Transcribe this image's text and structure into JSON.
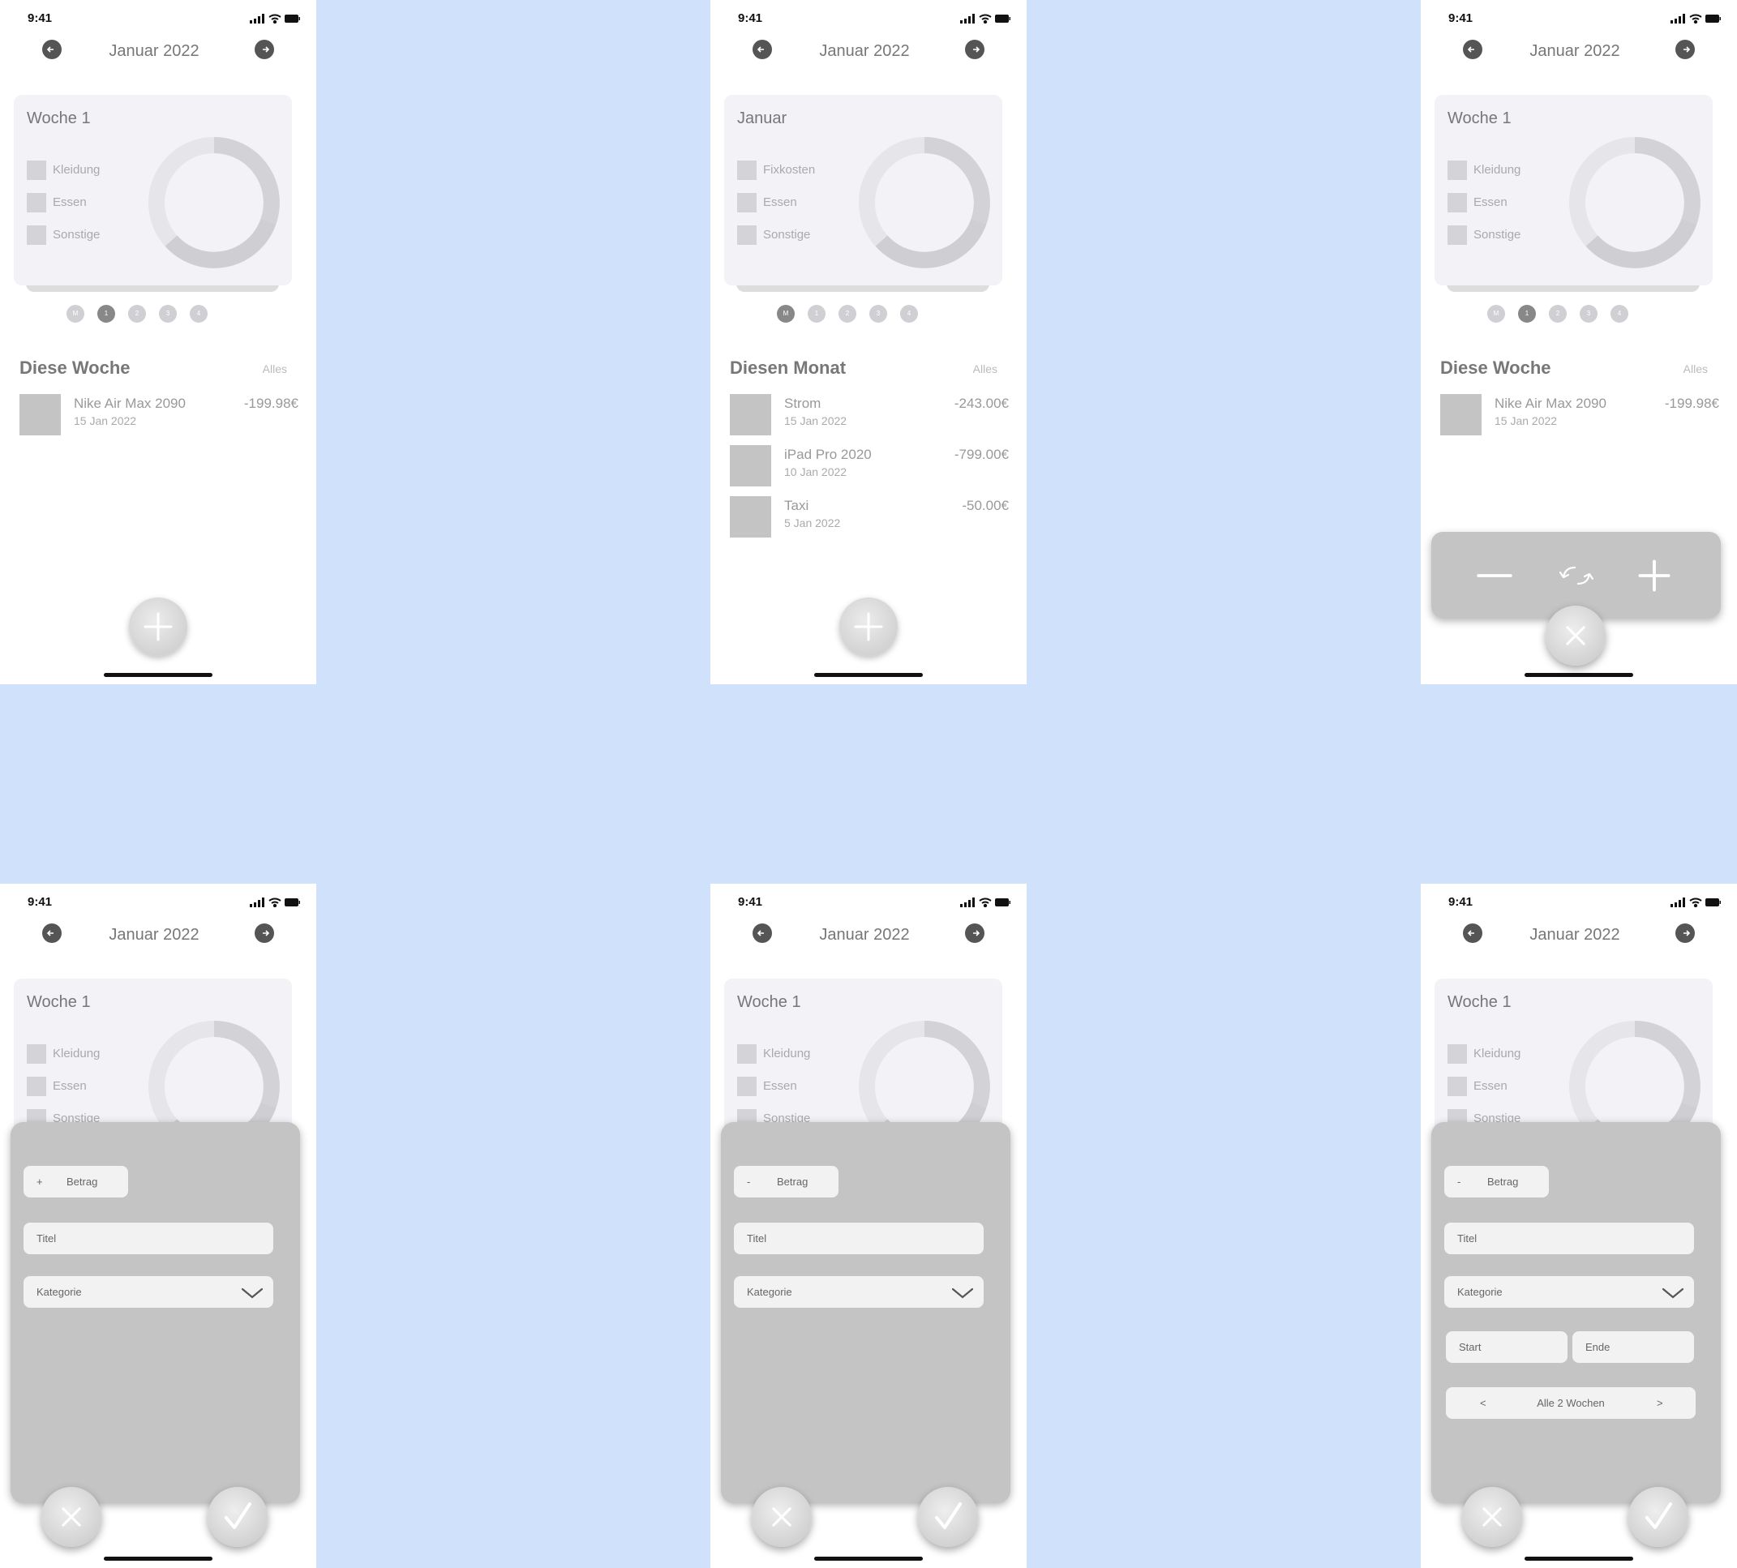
{
  "status": {
    "time": "9:41"
  },
  "nav": {
    "title": "Januar 2022"
  },
  "colors": {
    "background": "#cfe1fb",
    "card": "#f2f2f7",
    "sheet": "#c4c4c4"
  },
  "icons": {
    "prev": "arrow-left-icon",
    "next": "arrow-right-icon",
    "add": "plus-icon",
    "close": "close-icon",
    "confirm": "check-icon"
  },
  "screens": {
    "s1": {
      "card_title": "Woche 1",
      "legend": [
        "Kleidung",
        "Essen",
        "Sonstige"
      ],
      "dots": [
        "M",
        "1",
        "2",
        "3",
        "4"
      ],
      "active_dot": 1,
      "section_title": "Diese Woche",
      "section_link": "Alles",
      "transactions": [
        {
          "title": "Nike Air Max 2090",
          "date": "15 Jan 2022",
          "amount": "-199.98€"
        }
      ]
    },
    "s2": {
      "card_title": "Januar",
      "legend": [
        "Fixkosten",
        "Essen",
        "Sonstige"
      ],
      "dots": [
        "M",
        "1",
        "2",
        "3",
        "4"
      ],
      "active_dot": 0,
      "section_title": "Diesen Monat",
      "section_link": "Alles",
      "transactions": [
        {
          "title": "Strom",
          "date": "15 Jan 2022",
          "amount": "-243.00€"
        },
        {
          "title": "iPad Pro 2020",
          "date": "10 Jan 2022",
          "amount": "-799.00€"
        },
        {
          "title": "Taxi",
          "date": "5 Jan 2022",
          "amount": "-50.00€"
        }
      ]
    },
    "s3": {
      "card_title": "Woche 1",
      "legend": [
        "Kleidung",
        "Essen",
        "Sonstige"
      ],
      "dots": [
        "M",
        "1",
        "2",
        "3",
        "4"
      ],
      "active_dot": 1,
      "section_title": "Diese Woche",
      "section_link": "Alles",
      "transactions": [
        {
          "title": "Nike Air Max 2090",
          "date": "15 Jan 2022",
          "amount": "-199.98€"
        }
      ]
    },
    "s4": {
      "card_title": "Woche 1",
      "legend": [
        "Kleidung",
        "Essen",
        "Sonstige"
      ],
      "form": {
        "sign": "+",
        "amount_placeholder": "Betrag",
        "title_placeholder": "Titel",
        "category_placeholder": "Kategorie"
      }
    },
    "s5": {
      "card_title": "Woche 1",
      "legend": [
        "Kleidung",
        "Essen",
        "Sonstige"
      ],
      "form": {
        "sign": "-",
        "amount_placeholder": "Betrag",
        "title_placeholder": "Titel",
        "category_placeholder": "Kategorie"
      }
    },
    "s6": {
      "card_title": "Woche 1",
      "legend": [
        "Kleidung",
        "Essen",
        "Sonstige"
      ],
      "form": {
        "sign": "-",
        "amount_placeholder": "Betrag",
        "title_placeholder": "Titel",
        "category_placeholder": "Kategorie",
        "start_placeholder": "Start",
        "end_placeholder": "Ende",
        "interval_prev": "<",
        "interval_label": "Alle 2 Wochen",
        "interval_next": ">"
      }
    }
  }
}
